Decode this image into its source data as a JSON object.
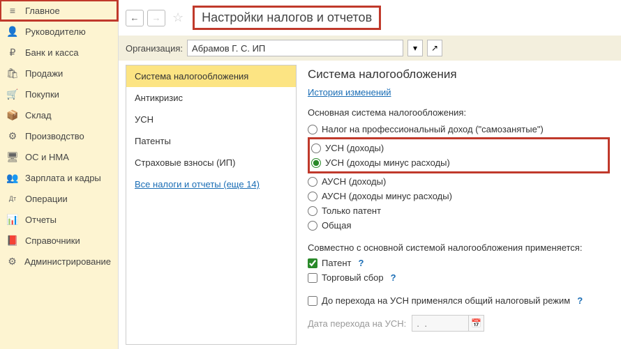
{
  "sidebar": {
    "items": [
      {
        "label": "Главное",
        "icon": "≡"
      },
      {
        "label": "Руководителю",
        "icon": "👤"
      },
      {
        "label": "Банк и касса",
        "icon": "₽"
      },
      {
        "label": "Продажи",
        "icon": "🛍"
      },
      {
        "label": "Покупки",
        "icon": "🛒"
      },
      {
        "label": "Склад",
        "icon": "📦"
      },
      {
        "label": "Производство",
        "icon": "⚙"
      },
      {
        "label": "ОС и НМА",
        "icon": "🖥"
      },
      {
        "label": "Зарплата и кадры",
        "icon": "👥"
      },
      {
        "label": "Операции",
        "icon": "Дт"
      },
      {
        "label": "Отчеты",
        "icon": "📊"
      },
      {
        "label": "Справочники",
        "icon": "📕"
      },
      {
        "label": "Администрирование",
        "icon": "⚙"
      }
    ]
  },
  "header": {
    "title": "Настройки налогов и отчетов"
  },
  "org": {
    "label": "Организация:",
    "value": "Абрамов Г. С. ИП"
  },
  "tabs": [
    {
      "label": "Система налогообложения",
      "active": true
    },
    {
      "label": "Антикризис"
    },
    {
      "label": "УСН"
    },
    {
      "label": "Патенты"
    },
    {
      "label": "Страховые взносы (ИП)"
    }
  ],
  "tabs_link": "Все налоги и отчеты (еще 14)",
  "panel": {
    "heading": "Система налогообложения",
    "history": "История изменений",
    "main_label": "Основная система налогообложения:",
    "radios": [
      "Налог на профессиональный доход (\"самозанятые\")",
      "УСН (доходы)",
      "УСН (доходы минус расходы)",
      "АУСН (доходы)",
      "АУСН (доходы минус расходы)",
      "Только патент",
      "Общая"
    ],
    "selected_radio": 2,
    "combo_label": "Совместно с основной системой налогообложения применяется:",
    "checks": [
      {
        "label": "Патент",
        "checked": true
      },
      {
        "label": "Торговый сбор",
        "checked": false
      }
    ],
    "transition": {
      "label": "До перехода на УСН применялся общий налоговый режим",
      "checked": false
    },
    "date_label": "Дата перехода на УСН:",
    "date_placeholder": ".  .",
    "help": "?"
  }
}
